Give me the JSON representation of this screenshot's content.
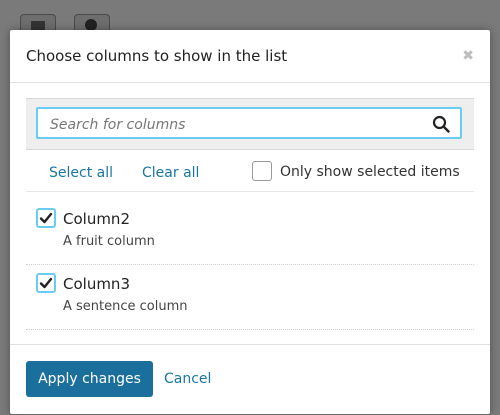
{
  "modal": {
    "title": "Choose columns to show in the list",
    "close_icon": "close-icon",
    "close_glyph": "✖"
  },
  "search": {
    "placeholder": "Search for columns",
    "value": "",
    "icon": "search-icon"
  },
  "controls": {
    "select_all": "Select all",
    "clear_all": "Clear all",
    "only_selected_label": "Only show selected items",
    "only_selected_checked": false
  },
  "columns": [
    {
      "name": "Column2",
      "description": "A fruit column",
      "checked": true
    },
    {
      "name": "Column3",
      "description": "A sentence column",
      "checked": true
    }
  ],
  "footer": {
    "apply_label": "Apply changes",
    "cancel_label": "Cancel"
  },
  "colors": {
    "primary_button": "#1b6f9c",
    "link": "#1b76a3",
    "focus_border": "#6ccbf3"
  }
}
